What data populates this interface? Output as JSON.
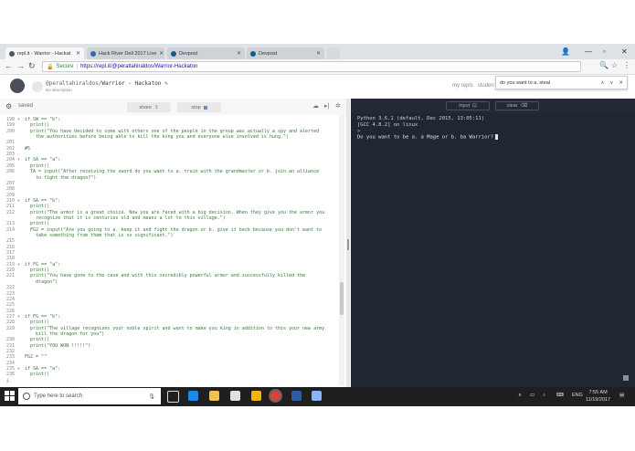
{
  "browser": {
    "tabs": [
      {
        "title": "repl.it - Warrior - Hackat",
        "active": true
      },
      {
        "title": "Hack River Dell 2017 Live",
        "active": false
      },
      {
        "title": "Devpost",
        "active": false
      },
      {
        "title": "Devpost",
        "active": false
      }
    ],
    "secure_label": "Secure",
    "url": "https://repl.it/@peraltahiraldos/Warrior-Hackaton",
    "find_query": "do you want to a. steal"
  },
  "repl": {
    "user": "@peraltahiraldos/",
    "project": "Warrior - Hackaton",
    "description": "No description",
    "right_links": [
      "my repls",
      "studen"
    ],
    "saved_label": "saved",
    "share_label": "share",
    "stop_label": "stop",
    "input_label": "input",
    "clear_label": "clear"
  },
  "code_lines": [
    {
      "n": "198",
      "fold": true,
      "t": "if SW == \"b\":"
    },
    {
      "n": "199",
      "t": "  print()"
    },
    {
      "n": "200",
      "t": "  print(\"You have decided to come with others one of the people in the group was actually a spy and alerted"
    },
    {
      "n": "",
      "t": "    the authorities before being able to kill the king you and everyone else involved is hung.\")"
    },
    {
      "n": "201",
      "t": ""
    },
    {
      "n": "202",
      "t": "#5"
    },
    {
      "n": "203",
      "t": ""
    },
    {
      "n": "204",
      "fold": true,
      "t": "if SA == \"a\":"
    },
    {
      "n": "205",
      "t": "  print()"
    },
    {
      "n": "206",
      "t": "  TA = input(\"After receiving the sword do you want to a. train with the grandmaster or b. join an alliance"
    },
    {
      "n": "",
      "t": "    to fight the dragon?\")"
    },
    {
      "n": "207",
      "t": ""
    },
    {
      "n": "208",
      "t": ""
    },
    {
      "n": "209",
      "t": ""
    },
    {
      "n": "210",
      "fold": true,
      "t": "if SA == \"b\":"
    },
    {
      "n": "211",
      "t": "  print()"
    },
    {
      "n": "212",
      "t": "  print(\"The armor is a great choice. Now you are faced with a big decision. When they give you the armor you"
    },
    {
      "n": "",
      "t": "    recognize that it is centuries old and means a lot to this village.\")"
    },
    {
      "n": "213",
      "t": "  print()"
    },
    {
      "n": "214",
      "t": "  FG2 = input(\"Are you going to a. keep it and fight the dragon or b. give it back because you don't want to"
    },
    {
      "n": "",
      "t": "    take something from them that is so significant.\")"
    },
    {
      "n": "215",
      "t": ""
    },
    {
      "n": "216",
      "t": ""
    },
    {
      "n": "217",
      "t": ""
    },
    {
      "n": "218",
      "t": ""
    },
    {
      "n": "219",
      "fold": true,
      "t": "if FG == \"a\":"
    },
    {
      "n": "220",
      "t": "  print()"
    },
    {
      "n": "221",
      "t": "  print(\"You have gone to the cave and with this incredibly powerful armor and successfully killed the"
    },
    {
      "n": "",
      "t": "    dragon\")"
    },
    {
      "n": "222",
      "t": ""
    },
    {
      "n": "223",
      "t": ""
    },
    {
      "n": "224",
      "t": ""
    },
    {
      "n": "225",
      "t": ""
    },
    {
      "n": "226",
      "t": ""
    },
    {
      "n": "227",
      "fold": true,
      "t": "if FG == \"b\":"
    },
    {
      "n": "228",
      "t": "  print()"
    },
    {
      "n": "229",
      "t": "  print(\"The village recognizes your noble spirit and want to make you king in addition to this your new army"
    },
    {
      "n": "",
      "t": "    kill the dragon for you\")"
    },
    {
      "n": "230",
      "t": "  print()"
    },
    {
      "n": "231",
      "t": "  print(\"YOU WON !!!!!\")"
    },
    {
      "n": "232",
      "t": ""
    },
    {
      "n": "233",
      "t": "FG2 = \"\""
    },
    {
      "n": "234",
      "t": ""
    },
    {
      "n": "235",
      "fold": true,
      "t": "if SA == \"a\":"
    },
    {
      "n": "236",
      "t": "  print()"
    }
  ],
  "console": {
    "lines": [
      "Python 3.6.1 (default, Dec 2015, 13:05:11)",
      "[GCC 4.8.2] on linux",
      ">",
      "Do you want to be a. a Mage or b. ba Warrior?"
    ]
  },
  "taskbar": {
    "search_placeholder": "Type here to search",
    "lang": "ENG",
    "time": "7:55 AM",
    "date": "11/19/2017"
  }
}
